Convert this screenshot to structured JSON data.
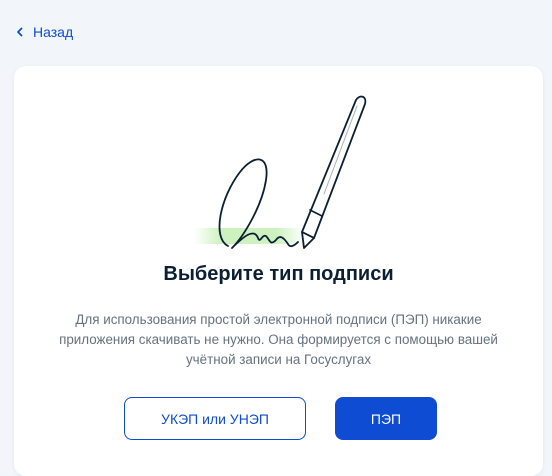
{
  "nav": {
    "back_label": "Назад"
  },
  "card": {
    "title": "Выберите тип подписи",
    "description": "Для использования простой электронной подписи (ПЭП) никакие приложения скачивать не нужно. Она формируется с помощью вашей учётной записи на Госуслугах"
  },
  "buttons": {
    "ukep_label": "УКЭП или УНЭП",
    "pep_label": "ПЭП"
  },
  "icons": {
    "back": "chevron-left-icon",
    "illustration": "pen-signature-illustration"
  },
  "colors": {
    "accent": "#0D4CD3",
    "background": "#F2F5FA",
    "text": "#0B1F33",
    "muted_text": "#66727F",
    "highlight": "#C8F0B8"
  }
}
